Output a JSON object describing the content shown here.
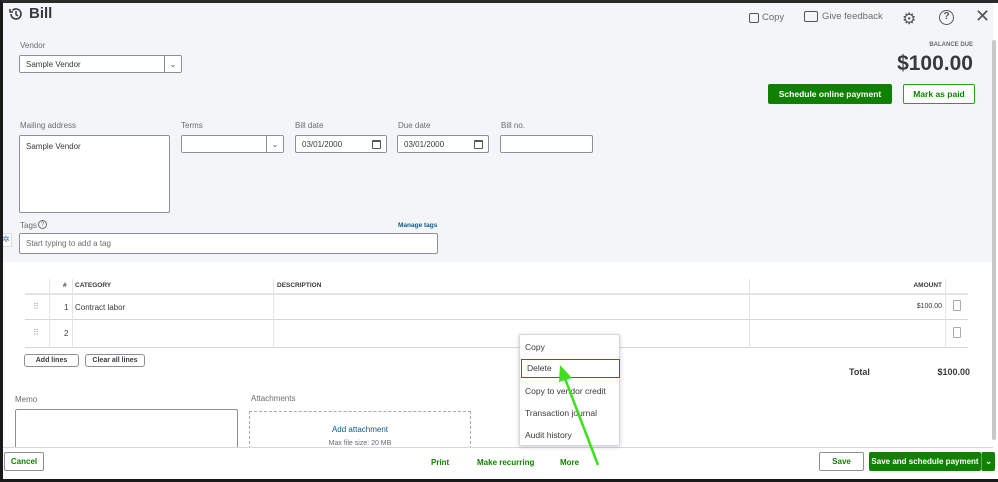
{
  "header": {
    "title": "Bill",
    "copy": "Copy",
    "feedback": "Give feedback"
  },
  "balance": {
    "label": "BALANCE DUE",
    "amount": "$100.00"
  },
  "buttons": {
    "schedule": "Schedule online payment",
    "mark_paid": "Mark as paid",
    "add_lines": "Add lines",
    "clear_lines": "Clear all lines"
  },
  "form": {
    "vendor_label": "Vendor",
    "vendor": "Sample Vendor",
    "mailing_label": "Mailing address",
    "mailing": "Sample Vendor",
    "terms_label": "Terms",
    "terms": "",
    "bill_date_label": "Bill date",
    "bill_date": "03/01/2000",
    "due_date_label": "Due date",
    "due_date": "03/01/2000",
    "bill_no_label": "Bill no.",
    "bill_no": "",
    "tags_label": "Tags",
    "manage_tags": "Manage tags",
    "tags_placeholder": "Start typing to add a tag"
  },
  "table": {
    "headers": [
      "#",
      "CATEGORY",
      "DESCRIPTION",
      "AMOUNT"
    ],
    "rows": [
      {
        "num": "1",
        "category": "Contract labor",
        "description": "",
        "amount": "$100.00"
      },
      {
        "num": "2",
        "category": "",
        "description": "",
        "amount": ""
      }
    ]
  },
  "total": {
    "label": "Total",
    "value": "$100.00"
  },
  "memo": {
    "label": "Memo"
  },
  "attachments": {
    "label": "Attachments",
    "add": "Add attachment",
    "max": "Max file size: 20 MB"
  },
  "menu": [
    "Copy",
    "Delete",
    "Copy to vendor credit",
    "Transaction journal",
    "Audit history"
  ],
  "footer": {
    "cancel": "Cancel",
    "print": "Print",
    "recurring": "Make recurring",
    "more": "More",
    "save": "Save",
    "save_schedule": "Save and schedule payment"
  }
}
